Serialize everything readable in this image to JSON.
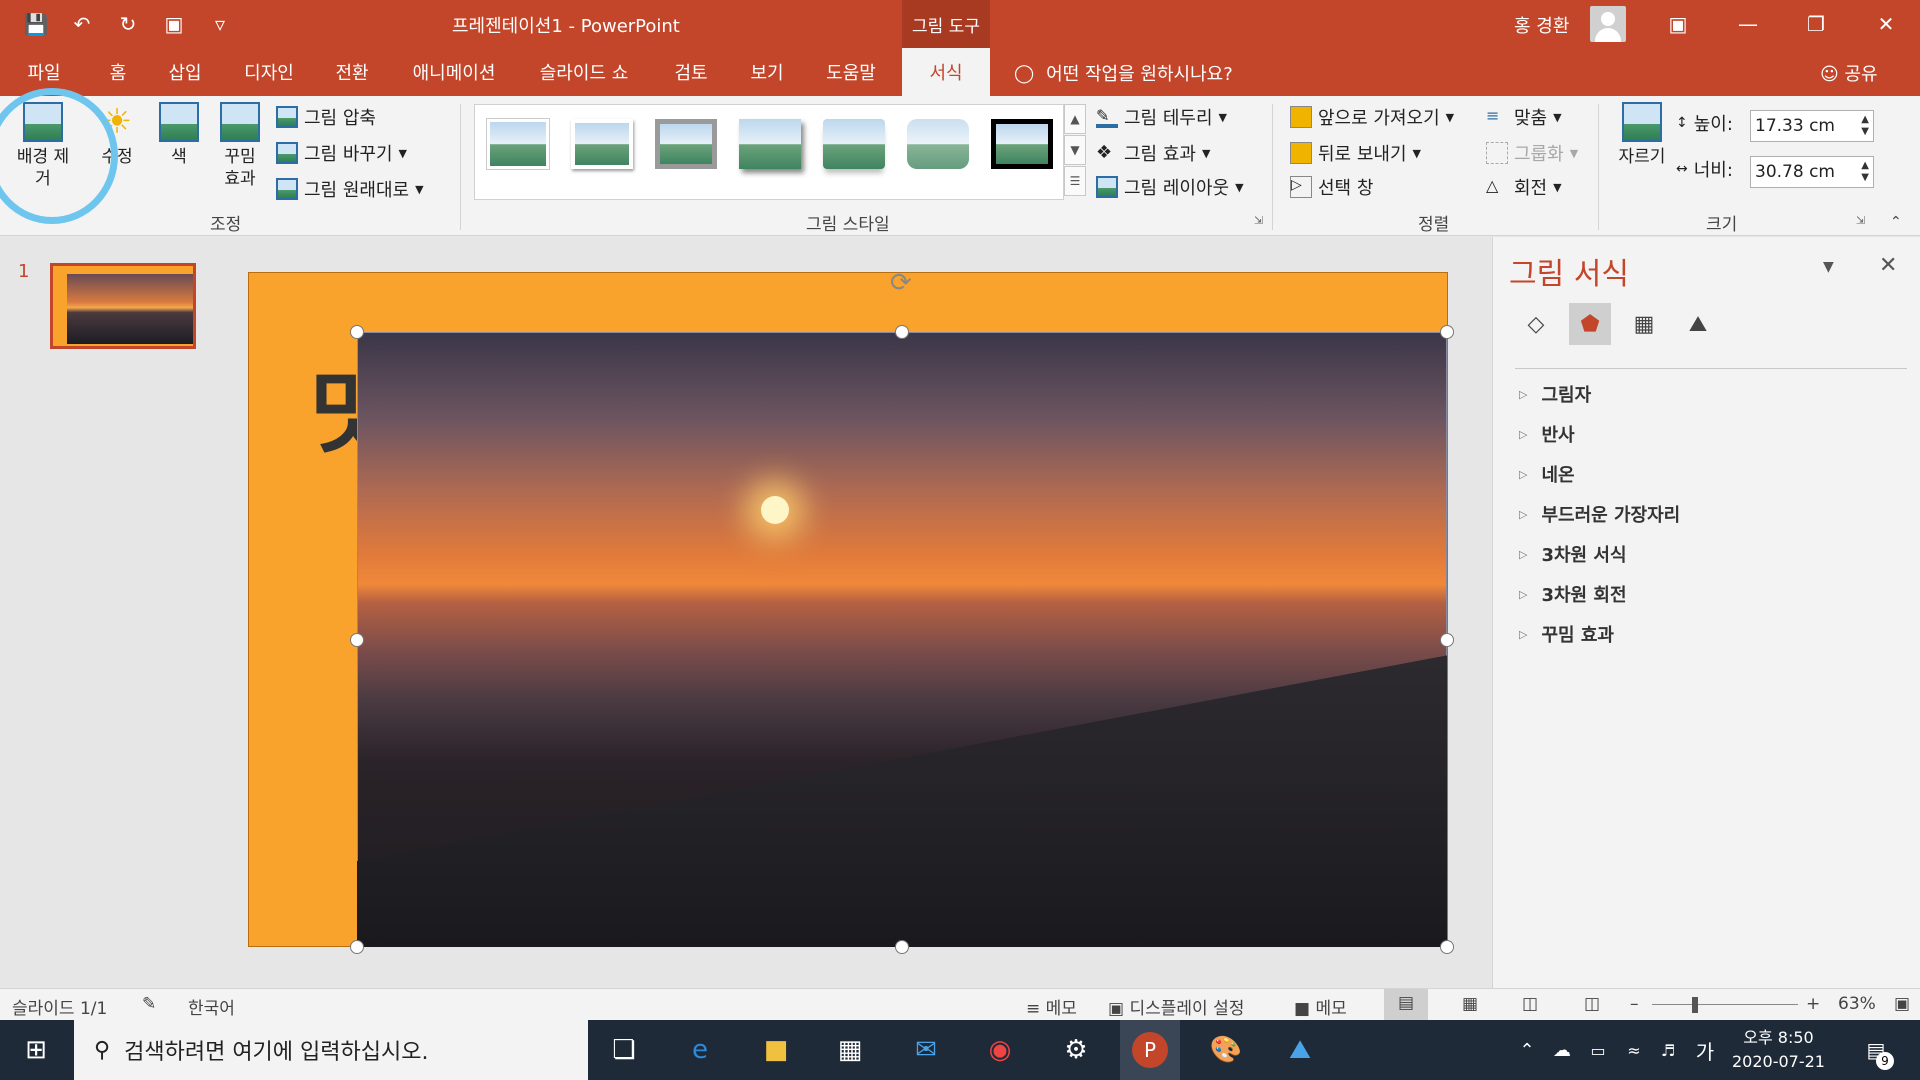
{
  "window": {
    "title": "프레젠테이션1  -  PowerPoint",
    "tools_label": "그림 도구",
    "user_name": "홍 경환"
  },
  "tabs": [
    {
      "label": "파일"
    },
    {
      "label": "홈"
    },
    {
      "label": "삽입"
    },
    {
      "label": "디자인"
    },
    {
      "label": "전환"
    },
    {
      "label": "애니메이션"
    },
    {
      "label": "슬라이드 쇼"
    },
    {
      "label": "검토"
    },
    {
      "label": "보기"
    },
    {
      "label": "도움말"
    },
    {
      "label": "서식",
      "active": true
    }
  ],
  "tell_me": "어떤 작업을 원하시나요?",
  "share": "공유",
  "ribbon": {
    "adjust": {
      "remove_bg": "배경 제거",
      "correct": "수정",
      "color": "색",
      "effects": "꾸밈 효과",
      "compress": "그림 압축",
      "change": "그림 바꾸기",
      "reset": "그림 원래대로",
      "label": "조정"
    },
    "styles": {
      "border": "그림 테두리",
      "effects": "그림 효과",
      "layout": "그림 레이아웃",
      "label": "그림 스타일"
    },
    "arrange": {
      "bring_forward": "앞으로 가져오기",
      "send_backward": "뒤로 보내기",
      "selection_pane": "선택 창",
      "align": "맞춤",
      "group": "그룹화",
      "rotate": "회전",
      "label": "정렬"
    },
    "size": {
      "crop": "자르기",
      "height_label": "높이:",
      "height_value": "17.33 cm",
      "width_label": "너비:",
      "width_value": "30.78 cm",
      "label": "크기"
    }
  },
  "thumbnails": {
    "slide_number": "1"
  },
  "slide": {
    "letter": "맛"
  },
  "pane": {
    "title": "그림 서식",
    "items": [
      "그림자",
      "반사",
      "네온",
      "부드러운 가장자리",
      "3차원 서식",
      "3차원 회전",
      "꾸밈 효과"
    ]
  },
  "status": {
    "slide": "슬라이드 1/1",
    "language": "한국어",
    "notes": "메모",
    "display": "디스플레이 설정",
    "comments": "메모",
    "zoom": "63%"
  },
  "taskbar": {
    "search_placeholder": "검색하려면 여기에 입력하십시오.",
    "ime": "가",
    "time": "오후 8:50",
    "date": "2020-07-21",
    "notifications": "9"
  },
  "colors": {
    "accent": "#c3462b",
    "slide_bg": "#f9a32c",
    "annotation": "#6ec6ef"
  }
}
